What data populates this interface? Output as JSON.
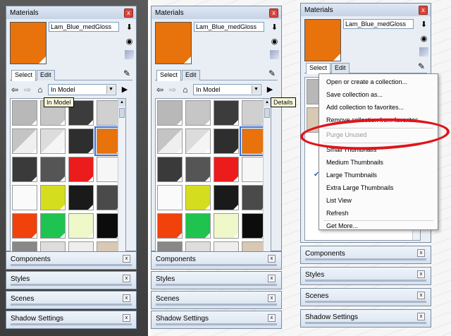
{
  "material_name": "Lam_Blue_medGloss",
  "panel_title": "Materials",
  "tabs": {
    "select": "Select",
    "edit": "Edit"
  },
  "collection": "In Model",
  "tooltips": {
    "in_model": "In Model",
    "details": "Details"
  },
  "trays": [
    "Components",
    "Styles",
    "Scenes",
    "Shadow Settings"
  ],
  "menu": {
    "items": [
      "Open or create a collection...",
      "Save collection as...",
      "Add collection to favorites...",
      "Remove collection from favorites...",
      "Purge Unused",
      "Small Thumbnails",
      "Medium Thumbnails",
      "Large Thumbnails",
      "Extra Large Thumbnails",
      "List View",
      "Refresh",
      "Get More..."
    ]
  },
  "colors": {
    "accent_orange": "#e8720c",
    "highlight_red": "#e0141b"
  }
}
